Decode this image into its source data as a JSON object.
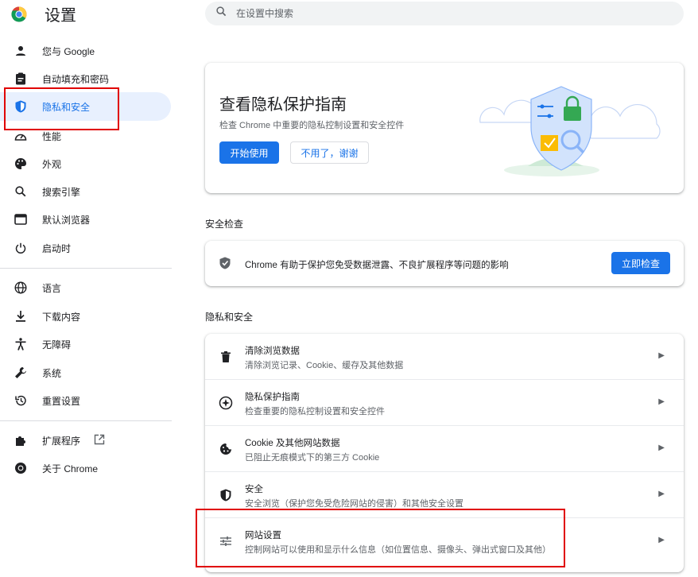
{
  "header": {
    "title": "设置",
    "search_placeholder": "在设置中搜索"
  },
  "sidebar": {
    "items": [
      {
        "label": "您与 Google",
        "icon": "person-icon"
      },
      {
        "label": "自动填充和密码",
        "icon": "clipboard-icon"
      },
      {
        "label": "隐私和安全",
        "icon": "shield-icon",
        "active": true
      },
      {
        "label": "性能",
        "icon": "speedometer-icon"
      },
      {
        "label": "外观",
        "icon": "palette-icon"
      },
      {
        "label": "搜索引擎",
        "icon": "search-icon"
      },
      {
        "label": "默认浏览器",
        "icon": "browser-window-icon"
      },
      {
        "label": "启动时",
        "icon": "power-icon"
      },
      {
        "label": "语言",
        "icon": "globe-icon"
      },
      {
        "label": "下载内容",
        "icon": "download-icon"
      },
      {
        "label": "无障碍",
        "icon": "accessibility-icon"
      },
      {
        "label": "系统",
        "icon": "wrench-icon"
      },
      {
        "label": "重置设置",
        "icon": "reset-history-icon"
      },
      {
        "label": "扩展程序",
        "icon": "puzzle-icon"
      },
      {
        "label": "关于 Chrome",
        "icon": "chrome-icon"
      }
    ]
  },
  "guide_card": {
    "title": "查看隐私保护指南",
    "subtitle": "检查 Chrome 中重要的隐私控制设置和安全控件",
    "start_label": "开始使用",
    "dismiss_label": "不用了，谢谢"
  },
  "safety_check": {
    "section_title": "安全检查",
    "text": "Chrome 有助于保护您免受数据泄露、不良扩展程序等问题的影响",
    "button_label": "立即检查"
  },
  "privacy": {
    "section_title": "隐私和安全",
    "rows": [
      {
        "title": "清除浏览数据",
        "subtitle": "清除浏览记录、Cookie、缓存及其他数据",
        "icon": "trash-icon"
      },
      {
        "title": "隐私保护指南",
        "subtitle": "检查重要的隐私控制设置和安全控件",
        "icon": "compass-icon"
      },
      {
        "title": "Cookie 及其他网站数据",
        "subtitle": "已阻止无痕模式下的第三方 Cookie",
        "icon": "cookie-icon"
      },
      {
        "title": "安全",
        "subtitle": "安全浏览（保护您免受危险网站的侵害）和其他安全设置",
        "icon": "security-shield-icon"
      },
      {
        "title": "网站设置",
        "subtitle": "控制网站可以使用和显示什么信息（如位置信息、摄像头、弹出式窗口及其他）",
        "icon": "sliders-icon"
      }
    ]
  },
  "colors": {
    "accent": "#1a73e8",
    "active_bg": "#e8f0fe",
    "highlight": "#e00000"
  }
}
